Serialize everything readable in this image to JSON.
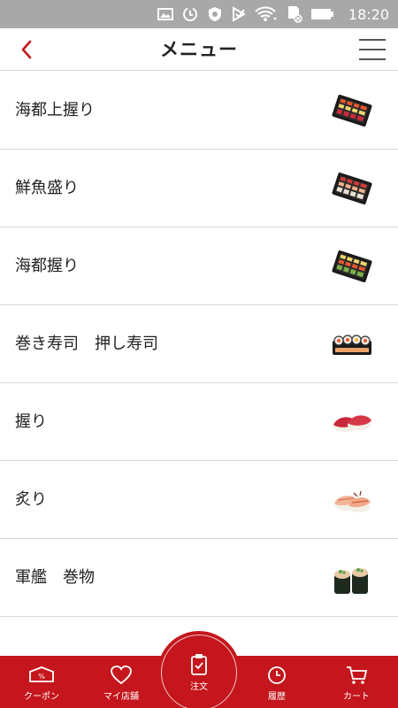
{
  "status_bar": {
    "time": "18:20",
    "icons": [
      "image-icon",
      "data-saver-icon",
      "shield-icon",
      "download-check-icon",
      "wifi-icon",
      "sd-card-icon",
      "battery-icon"
    ]
  },
  "header": {
    "title": "メニュー",
    "back_icon": "chevron-left-icon",
    "menu_icon": "hamburger-icon"
  },
  "menu": {
    "items": [
      {
        "label": "海都上握り",
        "thumb": "sushi-platter-icon"
      },
      {
        "label": "鮮魚盛り",
        "thumb": "sushi-platter-icon"
      },
      {
        "label": "海都握り",
        "thumb": "sushi-platter-icon"
      },
      {
        "label": "巻き寿司　押し寿司",
        "thumb": "sushi-rolls-icon"
      },
      {
        "label": "握り",
        "thumb": "tuna-nigiri-icon"
      },
      {
        "label": "炙り",
        "thumb": "shrimp-nigiri-icon"
      },
      {
        "label": "軍艦　巻物",
        "thumb": "gunkan-icon"
      }
    ]
  },
  "bottom_nav": {
    "items": [
      {
        "label": "クーポン",
        "icon": "coupon-icon"
      },
      {
        "label": "マイ店舗",
        "icon": "heart-icon"
      },
      {
        "label": "注文",
        "icon": "clipboard-check-icon"
      },
      {
        "label": "履歴",
        "icon": "clock-icon"
      },
      {
        "label": "カート",
        "icon": "cart-icon"
      }
    ],
    "color": "#c4161c"
  },
  "colors": {
    "accent": "#c4161c",
    "status_bar": "#a8a8a8",
    "divider": "#d8d8d8"
  }
}
